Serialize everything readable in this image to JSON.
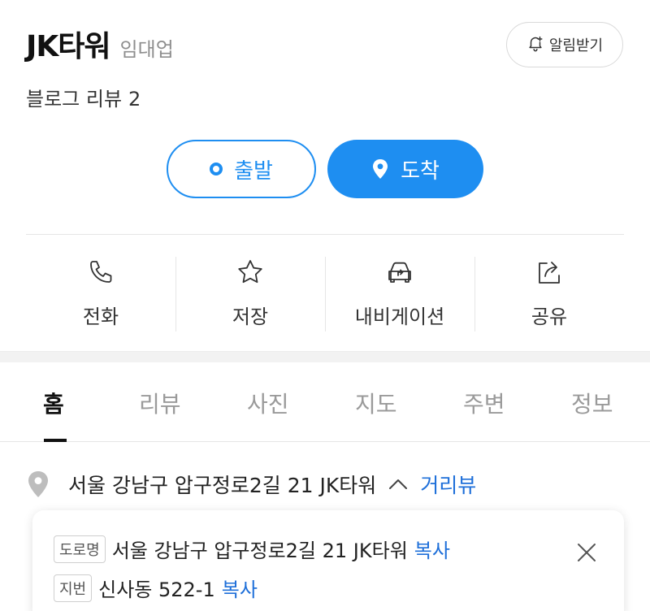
{
  "place": {
    "name": "JK타워",
    "category": "임대업"
  },
  "notify": {
    "label": "알림받기",
    "icon": "bell-plus-icon"
  },
  "review": {
    "label": "블로그 리뷰",
    "count": "2"
  },
  "route": {
    "depart_label": "출발",
    "arrive_label": "도착"
  },
  "actions": [
    {
      "label": "전화",
      "icon": "phone-icon"
    },
    {
      "label": "저장",
      "icon": "star-icon"
    },
    {
      "label": "내비게이션",
      "icon": "car-navigation-icon"
    },
    {
      "label": "공유",
      "icon": "share-icon"
    }
  ],
  "tabs": [
    {
      "label": "홈",
      "active": true
    },
    {
      "label": "리뷰",
      "active": false
    },
    {
      "label": "사진",
      "active": false
    },
    {
      "label": "지도",
      "active": false
    },
    {
      "label": "주변",
      "active": false
    },
    {
      "label": "정보",
      "active": false
    }
  ],
  "address": {
    "summary": "서울 강남구 압구정로2길 21 JK타워",
    "street_view_link": "거리뷰",
    "road_tag": "도로명",
    "road_value": "서울 강남구 압구정로2길 21 JK타워",
    "lot_tag": "지번",
    "lot_value": "신사동 522-1",
    "copy_label": "복사"
  },
  "colors": {
    "accent": "#1e8ef1",
    "link": "#1e6fd9",
    "muted": "#8e8e8e"
  }
}
